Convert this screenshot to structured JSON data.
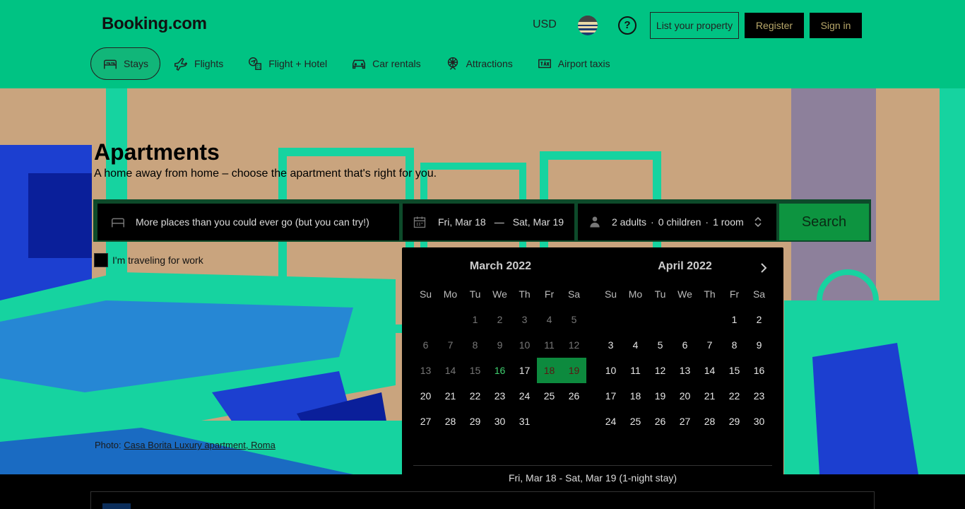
{
  "header": {
    "logo": "Booking.com",
    "currency": "USD",
    "help_icon": "question-circle-icon",
    "list_property": "List your property",
    "register": "Register",
    "sign_in": "Sign in",
    "colors": {
      "brand_green": "#00c383",
      "button_dark": "#000000"
    }
  },
  "nav": {
    "items": [
      {
        "label": "Stays",
        "icon": "bed-icon",
        "active": true
      },
      {
        "label": "Flights",
        "icon": "plane-icon",
        "active": false
      },
      {
        "label": "Flight + Hotel",
        "icon": "plane-hotel-icon",
        "active": false
      },
      {
        "label": "Car rentals",
        "icon": "car-icon",
        "active": false
      },
      {
        "label": "Attractions",
        "icon": "attractions-icon",
        "active": false
      },
      {
        "label": "Airport taxis",
        "icon": "taxi-icon",
        "active": false
      }
    ]
  },
  "hero": {
    "title": "Apartments",
    "subtitle": "A home away from home – choose the apartment that's right for you.",
    "photo_prefix": "Photo: ",
    "photo_link": "Casa Borita Luxury apartment, Roma"
  },
  "search": {
    "destination_placeholder": "More places than you could ever go (but you can try!)",
    "checkin": "Fri, Mar 18",
    "date_sep": "—",
    "checkout": "Sat, Mar 19",
    "adults": "2 adults",
    "children": "0 children",
    "rooms": "1 room",
    "dot": "·",
    "button": "Search",
    "work_label": "I'm traveling for work"
  },
  "calendar": {
    "weekdays": [
      "Su",
      "Mo",
      "Tu",
      "We",
      "Th",
      "Fr",
      "Sa"
    ],
    "months": [
      {
        "title": "March 2022",
        "first_weekday": 2,
        "days": 31,
        "past_until": 15,
        "today": 16,
        "selected": [
          18,
          19
        ]
      },
      {
        "title": "April 2022",
        "first_weekday": 5,
        "days": 30,
        "past_until": 0,
        "today": 0,
        "selected": []
      }
    ],
    "footer": "Fri, Mar 18 - Sat, Mar 19 (1-night stay)"
  }
}
